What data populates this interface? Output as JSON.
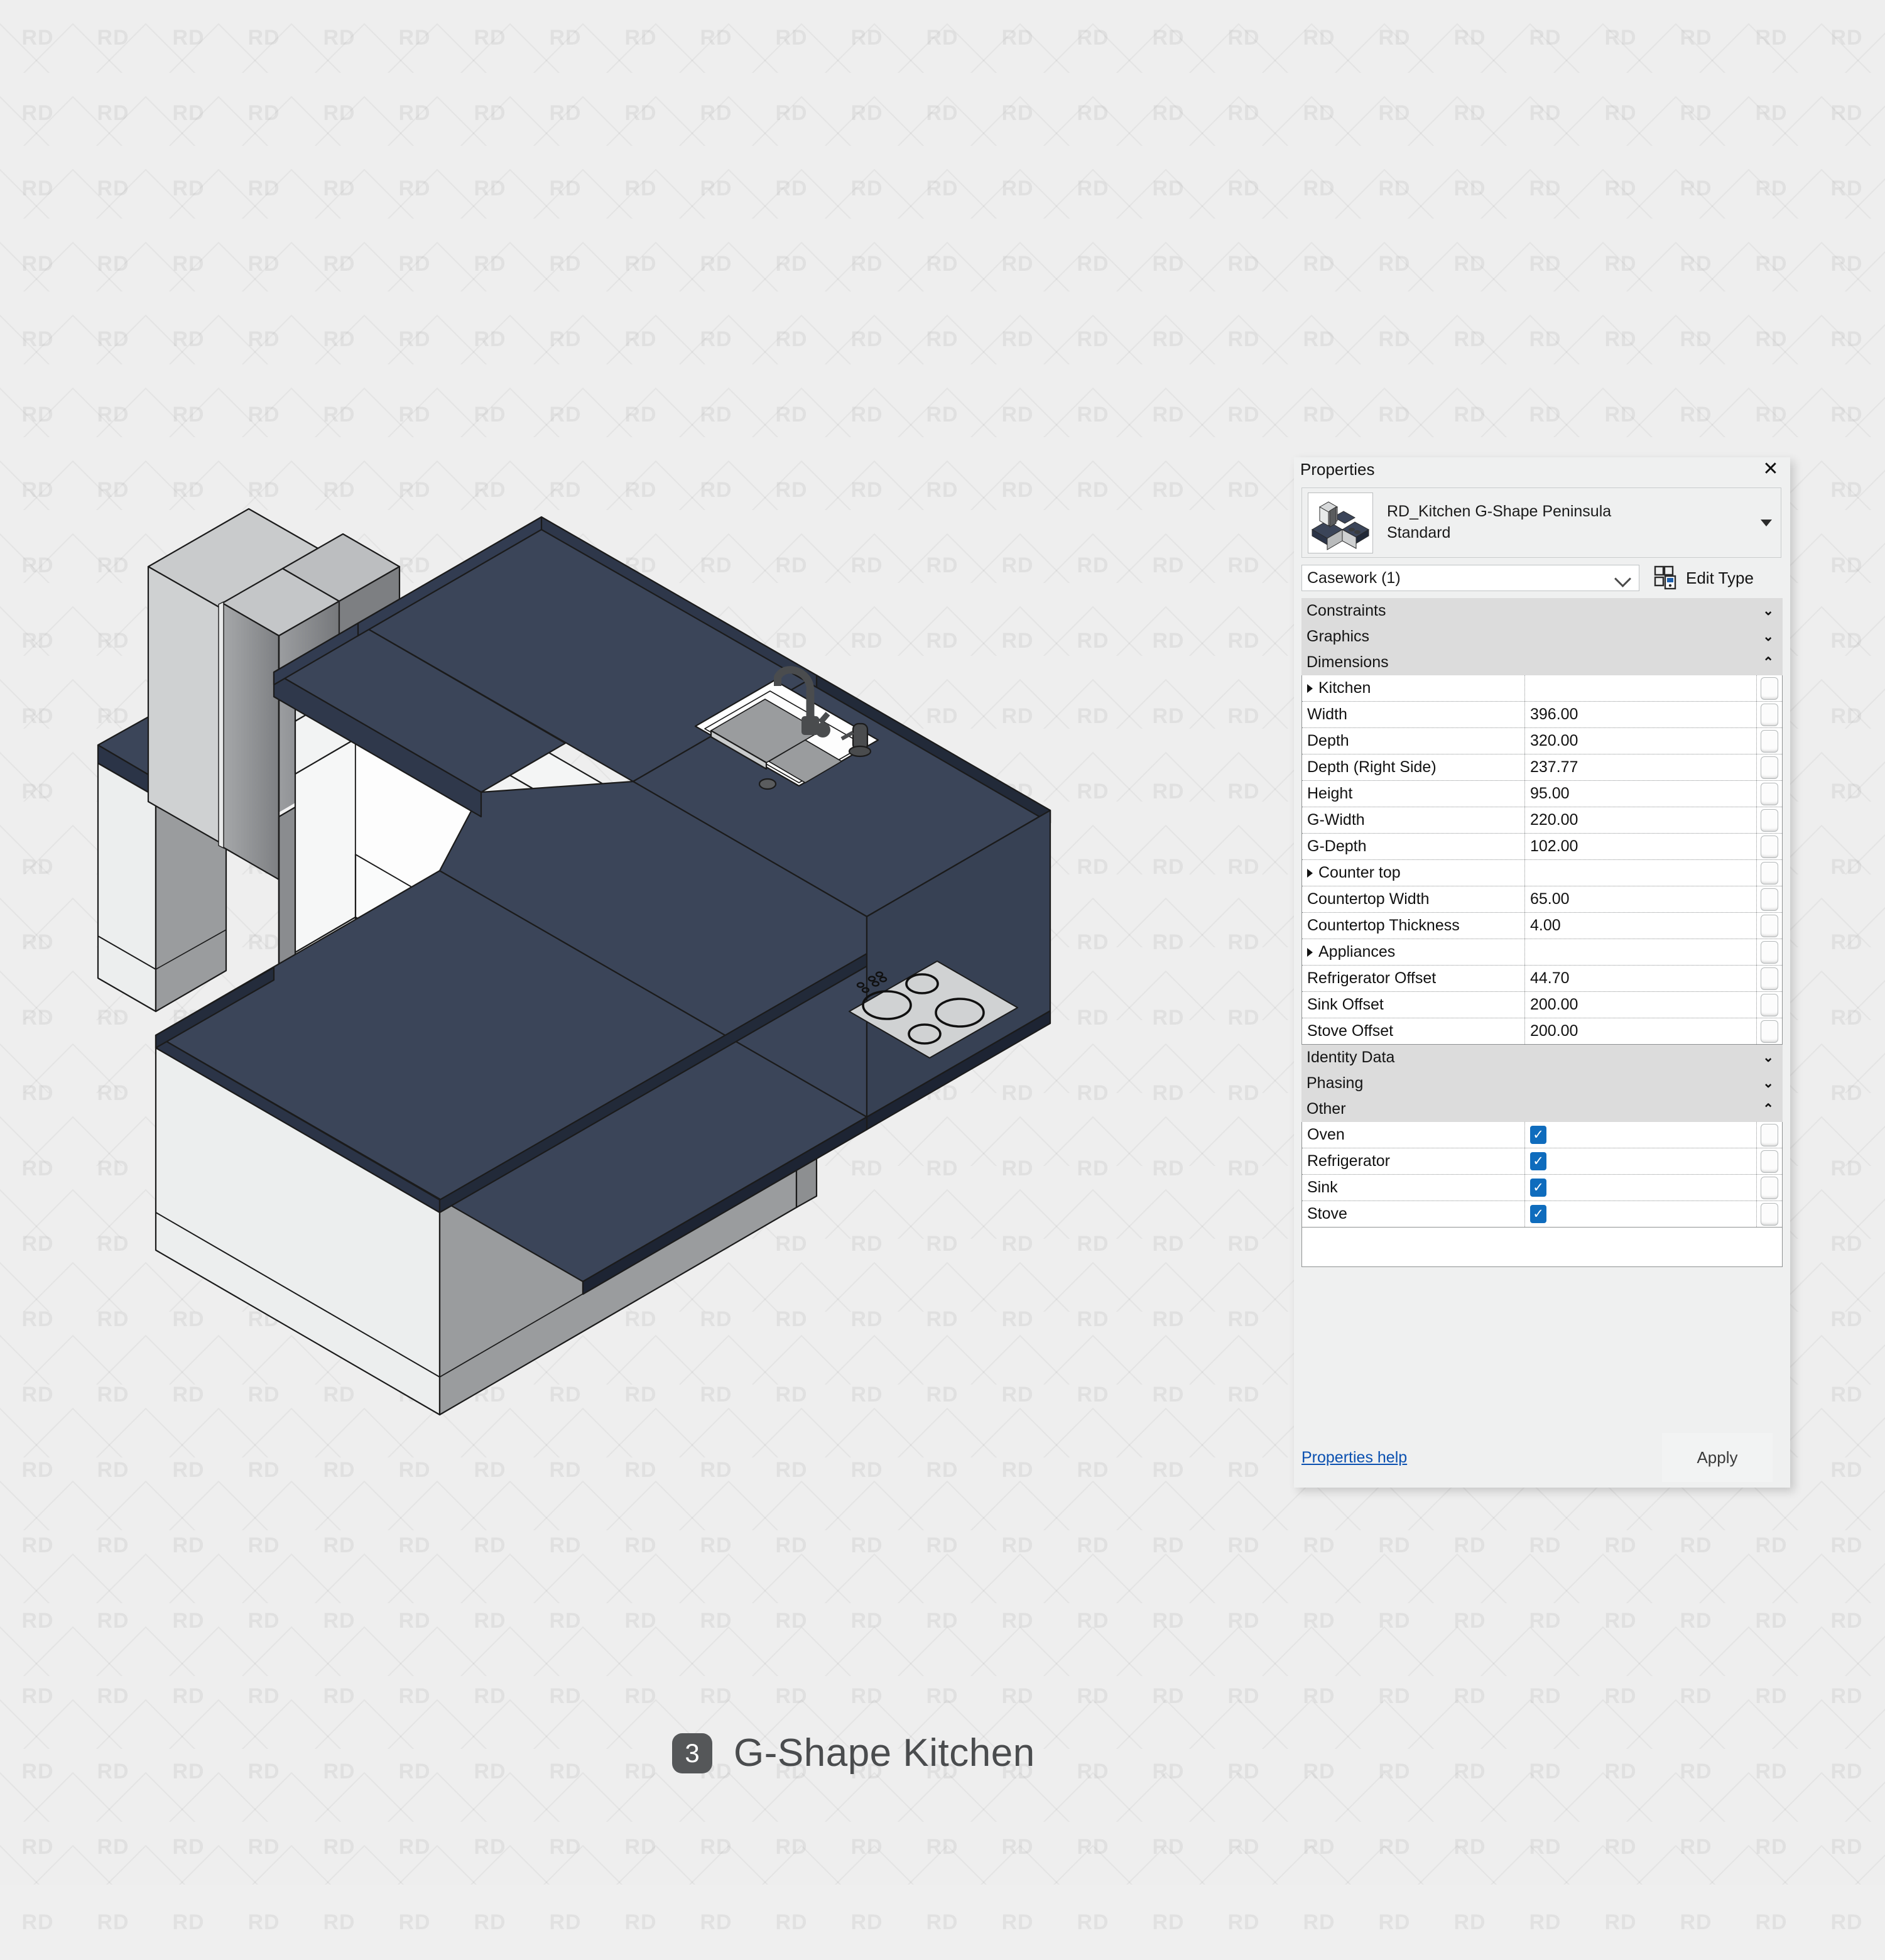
{
  "watermark": {
    "text": "RD"
  },
  "panel": {
    "title": "Properties",
    "close_icon": "close-icon",
    "type_name": "RD_Kitchen G-Shape Peninsula Standard",
    "type_name_line1": "RD_Kitchen G-Shape Peninsula",
    "type_name_line2": "Standard",
    "category_value": "Casework (1)",
    "edit_type_label": "Edit Type",
    "help_label": "Properties help",
    "apply_label": "Apply",
    "groups": [
      {
        "label": "Constraints",
        "state": "collapsed",
        "chevron": "chevron-double-down"
      },
      {
        "label": "Graphics",
        "state": "collapsed",
        "chevron": "chevron-double-down"
      },
      {
        "label": "Dimensions",
        "state": "expanded",
        "chevron": "chevron-double-up"
      },
      {
        "label": "Identity Data",
        "state": "collapsed",
        "chevron": "chevron-double-down"
      },
      {
        "label": "Phasing",
        "state": "collapsed",
        "chevron": "chevron-double-down"
      },
      {
        "label": "Other",
        "state": "expanded",
        "chevron": "chevron-double-up"
      }
    ],
    "dimensions_rows": [
      {
        "name": "Kitchen",
        "value": "",
        "header": true,
        "type": "text"
      },
      {
        "name": "Width",
        "value": "396.00",
        "header": false,
        "type": "text"
      },
      {
        "name": "Depth",
        "value": "320.00",
        "header": false,
        "type": "text"
      },
      {
        "name": "Depth (Right Side)",
        "value": "237.77",
        "header": false,
        "type": "text"
      },
      {
        "name": "Height",
        "value": "95.00",
        "header": false,
        "type": "text"
      },
      {
        "name": "G-Width",
        "value": "220.00",
        "header": false,
        "type": "text"
      },
      {
        "name": "G-Depth",
        "value": "102.00",
        "header": false,
        "type": "text"
      },
      {
        "name": "Counter top",
        "value": "",
        "header": true,
        "type": "text"
      },
      {
        "name": "Countertop Width",
        "value": "65.00",
        "header": false,
        "type": "text"
      },
      {
        "name": "Countertop Thickness",
        "value": "4.00",
        "header": false,
        "type": "text"
      },
      {
        "name": "Appliances",
        "value": "",
        "header": true,
        "type": "text"
      },
      {
        "name": "Refrigerator Offset",
        "value": "44.70",
        "header": false,
        "type": "text"
      },
      {
        "name": "Sink Offset",
        "value": "200.00",
        "header": false,
        "type": "text"
      },
      {
        "name": "Stove Offset",
        "value": "200.00",
        "header": false,
        "type": "text"
      }
    ],
    "other_rows": [
      {
        "name": "Oven",
        "checked": true
      },
      {
        "name": "Refrigerator",
        "checked": true
      },
      {
        "name": "Sink",
        "checked": true
      },
      {
        "name": "Stove",
        "checked": true
      }
    ]
  },
  "caption": {
    "number": "3",
    "title": "G-Shape Kitchen"
  },
  "colors": {
    "countertop": "#3b4559",
    "countertop_edge": "#222a39",
    "cabinet_front": "#eceeee",
    "cabinet_side": "#9a9c9e",
    "cabinet_top": "#c9cbcc",
    "appliance_body": "#8e9093",
    "appliance_light": "#b9bbbd",
    "accent_blue": "#0f6cbd",
    "link_blue": "#0a50b0",
    "background": "#eeeeee",
    "caption_text": "#4a4c4e"
  }
}
